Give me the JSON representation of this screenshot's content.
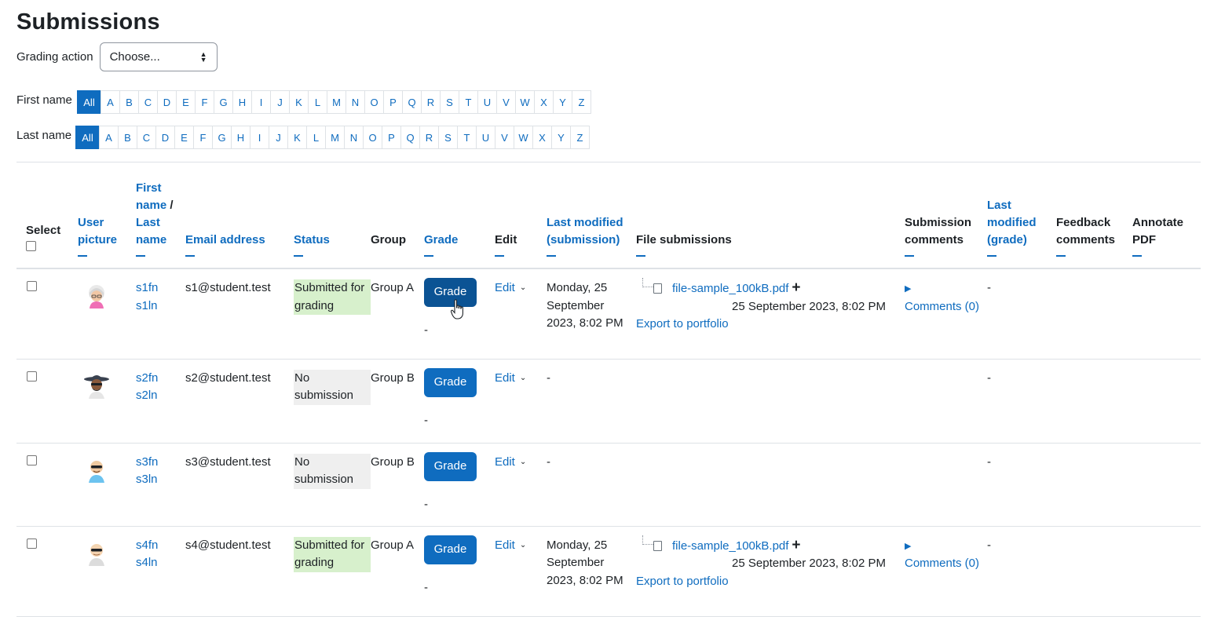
{
  "page": {
    "title": "Submissions"
  },
  "grading_action": {
    "label": "Grading action",
    "selected": "Choose..."
  },
  "initials": {
    "first_label": "First name",
    "last_label": "Last name",
    "all": "All",
    "letters": [
      "A",
      "B",
      "C",
      "D",
      "E",
      "F",
      "G",
      "H",
      "I",
      "J",
      "K",
      "L",
      "M",
      "N",
      "O",
      "P",
      "Q",
      "R",
      "S",
      "T",
      "U",
      "V",
      "W",
      "X",
      "Y",
      "Z"
    ]
  },
  "columns": {
    "select": "Select",
    "user_picture": "User picture",
    "first_name": "First name",
    "slash": " / ",
    "last_name": "Last name",
    "email": "Email address",
    "status": "Status",
    "group": "Group",
    "grade": "Grade",
    "edit": "Edit",
    "last_modified_submission": "Last modified (submission)",
    "file_submissions": "File submissions",
    "submission_comments": "Submission comments",
    "last_modified_grade": "Last modified (grade)",
    "feedback_comments": "Feedback comments",
    "annotate_pdf": "Annotate PDF"
  },
  "rows": [
    {
      "first": "s1fn",
      "last": "s1ln",
      "email": "s1@student.test",
      "status": "Submitted for grading",
      "status_kind": "ok",
      "group": "Group A",
      "grade_button": "Grade",
      "grade_value": "-",
      "edit": "Edit",
      "modified": "Monday, 25 September 2023, 8:02 PM",
      "file": "file-sample_100kB.pdf",
      "file_date": "25 September 2023, 8:02 PM",
      "export": "Export to portfolio",
      "comments": "Comments (0)",
      "modified_grade": "-"
    },
    {
      "first": "s2fn",
      "last": "s2ln",
      "email": "s2@student.test",
      "status": "No submission",
      "status_kind": "none",
      "group": "Group B",
      "grade_button": "Grade",
      "grade_value": "-",
      "edit": "Edit",
      "modified": "-",
      "modified_grade": "-"
    },
    {
      "first": "s3fn",
      "last": "s3ln",
      "email": "s3@student.test",
      "status": "No submission",
      "status_kind": "none",
      "group": "Group B",
      "grade_button": "Grade",
      "grade_value": "-",
      "edit": "Edit",
      "modified": "-",
      "modified_grade": "-"
    },
    {
      "first": "s4fn",
      "last": "s4ln",
      "email": "s4@student.test",
      "status": "Submitted for grading",
      "status_kind": "ok",
      "group": "Group A",
      "grade_button": "Grade",
      "grade_value": "-",
      "edit": "Edit",
      "modified": "Monday, 25 September 2023, 8:02 PM",
      "file": "file-sample_100kB.pdf",
      "file_date": "25 September 2023, 8:02 PM",
      "export": "Export to portfolio",
      "comments": "Comments (0)",
      "modified_grade": "-"
    }
  ],
  "icons": {
    "select_arrows": "sort-arrows-icon",
    "chevron": "chevron-down-icon",
    "file": "pdf-file-icon",
    "plus": "plus-icon",
    "expand": "caret-right-icon"
  },
  "colors": {
    "link": "#0f6cbf",
    "submitted_bg": "#d7f0cc",
    "nosub_bg": "#efefef"
  }
}
